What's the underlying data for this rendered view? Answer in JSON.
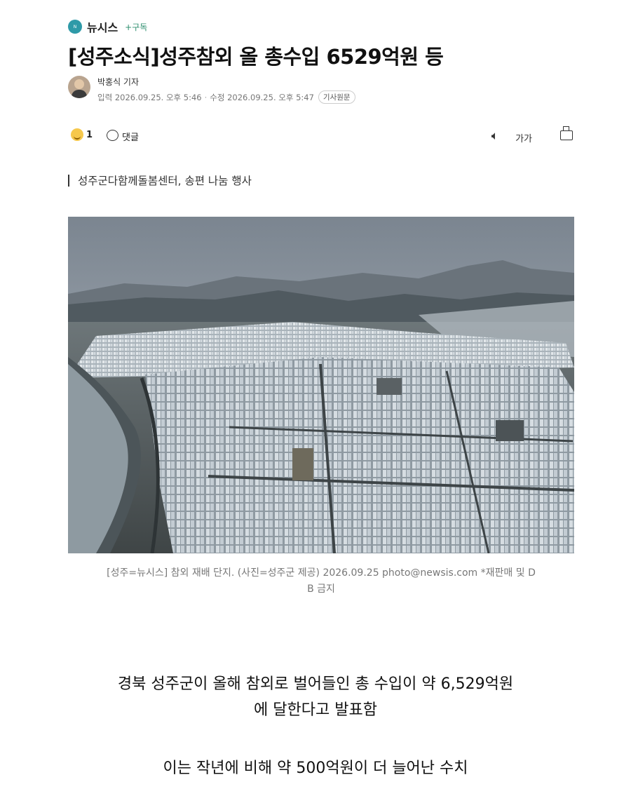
{
  "header": {
    "press_name": "뉴시스",
    "subscribe_label": "+구독",
    "title": "[성주소식]성주참외 올 총수입 6529억원 등"
  },
  "author": {
    "name": "박홍식 기자",
    "input_label": "입력 2026.09.25. 오후 5:46",
    "modified_label": "수정 2026.09.25. 오후 5:47",
    "original_article_button": "기사원문"
  },
  "toolbar": {
    "reaction_count": "1",
    "comment_label": "댓글",
    "font_size_label": "가가"
  },
  "subheading": "성주군다함께돌봄센터, 송편 나눔 행사",
  "photo": {
    "caption_line1": "[성주=뉴시스] 참외 재배 단지. (사진=성주군 제공) 2026.09.25 photo@newsis.com *재판매 및 D",
    "caption_line2": "B 금지"
  },
  "body": {
    "paragraph1_line1": "경북 성주군이 올해 참외로 벌어들인 총 수입이 약 6,529억원",
    "paragraph1_line2": "에 달한다고 발표함",
    "paragraph2": "이는 작년에 비해 약 500억원이 더 늘어난 수치"
  },
  "colors": {
    "brand_green": "#2f8f6f",
    "logo_teal": "#2e9aa8",
    "caption_gray": "#777777"
  },
  "icons": [
    "reaction-emoji-icon",
    "comment-icon",
    "speaker-icon",
    "font-size-icon",
    "print-icon"
  ]
}
